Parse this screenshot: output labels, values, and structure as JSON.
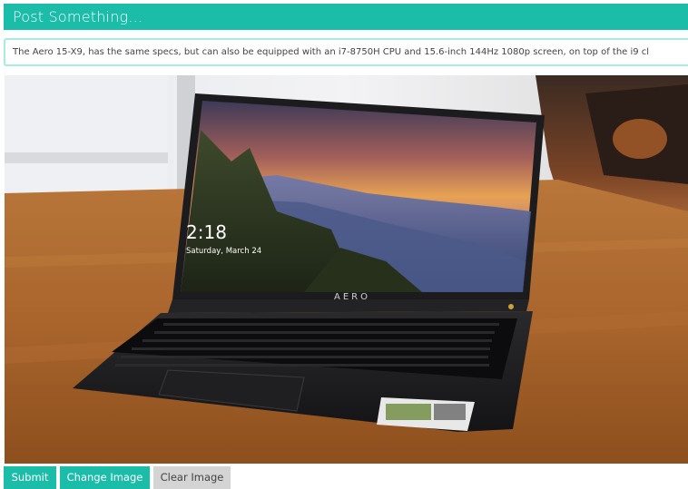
{
  "header": {
    "title": "Post Something..."
  },
  "post_input": {
    "value": "The Aero 15-X9, has the same specs, but can also be equipped with an i7-8750H CPU and 15.6-inch 144Hz 1080p screen, on top of the i9 cl"
  },
  "image": {
    "screen_time": "2:18",
    "screen_date": "Saturday, March 24",
    "brand_text": "AERO"
  },
  "buttons": {
    "submit_label": "Submit",
    "change_label": "Change Image",
    "clear_label": "Clear Image"
  },
  "colors": {
    "accent": "#1bbca8",
    "input_border": "#a8ece0",
    "clear_bg": "#d4d4d4"
  }
}
